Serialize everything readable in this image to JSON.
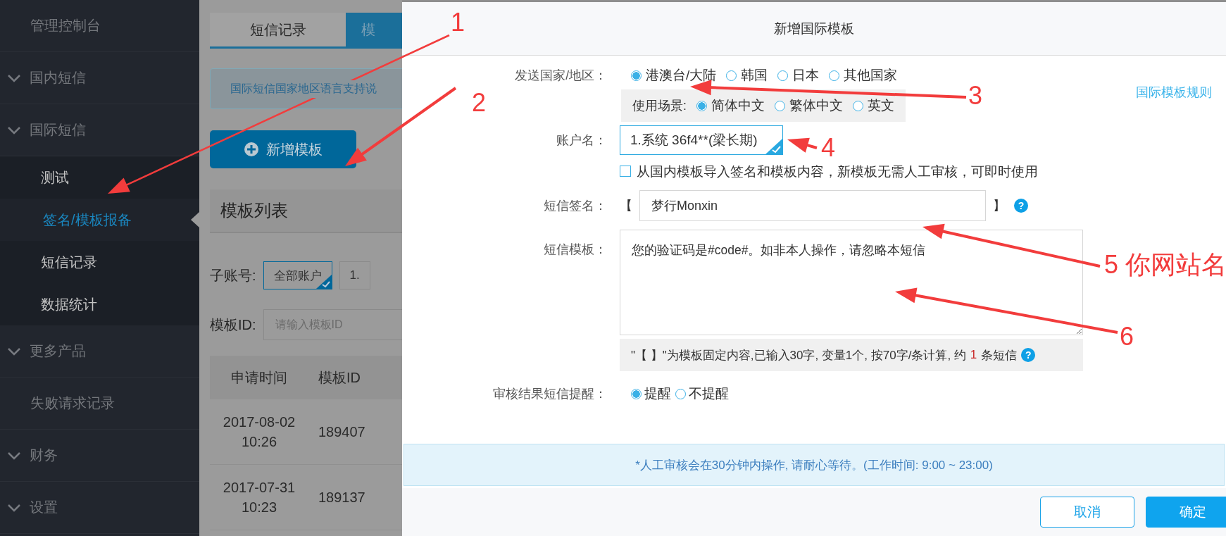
{
  "sidebar": {
    "items": [
      {
        "label": "管理控制台",
        "kind": "link",
        "selected": false
      },
      {
        "label": "国内短信",
        "kind": "group",
        "selected": false
      },
      {
        "label": "国际短信",
        "kind": "group",
        "selected": false,
        "children": [
          {
            "label": "测试",
            "selected": false
          },
          {
            "label": "签名/模板报备",
            "selected": true
          },
          {
            "label": "短信记录",
            "selected": false
          },
          {
            "label": "数据统计",
            "selected": false
          }
        ]
      },
      {
        "label": "更多产品",
        "kind": "group",
        "selected": false
      },
      {
        "label": "失败请求记录",
        "kind": "link",
        "selected": false
      },
      {
        "label": "财务",
        "kind": "group",
        "selected": false
      },
      {
        "label": "设置",
        "kind": "group",
        "selected": false
      }
    ]
  },
  "page": {
    "tabs": [
      {
        "label": "短信记录",
        "selected": false
      },
      {
        "label": "模",
        "selected": true
      }
    ],
    "notice": "国际短信国家地区语言支持说",
    "add_button": "新增模板",
    "list_title": "模板列表",
    "subaccount": {
      "label": "子账号:",
      "options": [
        {
          "label": "全部账户",
          "selected": true
        },
        {
          "label": "1.",
          "selected": false
        }
      ]
    },
    "template_id": {
      "label": "模板ID:",
      "placeholder": "请输入模板ID"
    },
    "table": {
      "columns": [
        "申请时间",
        "模板ID"
      ],
      "rows": [
        [
          "2017-08-02\n10:26",
          "189407"
        ],
        [
          "2017-07-31\n10:23",
          "189137"
        ]
      ]
    }
  },
  "dialog": {
    "title": "新增国际模板",
    "rules_link": "国际模板规则",
    "country": {
      "label": "发送国家/地区：",
      "options": [
        {
          "label": "港澳台/大陆",
          "selected": true
        },
        {
          "label": "韩国",
          "selected": false
        },
        {
          "label": "日本",
          "selected": false
        },
        {
          "label": "其他国家",
          "selected": false
        }
      ]
    },
    "scene": {
      "label": "使用场景:",
      "options": [
        {
          "label": "简体中文",
          "selected": true
        },
        {
          "label": "繁体中文",
          "selected": false
        },
        {
          "label": "英文",
          "selected": false
        }
      ]
    },
    "account": {
      "label": "账户名：",
      "value": "1.系统 36f4**(梁长期)"
    },
    "import": {
      "label": "从国内模板导入签名和模板内容，新模板无需人工审核，可即时使用",
      "checked": false
    },
    "signature": {
      "label": "短信签名：",
      "open": "【",
      "close": "】",
      "value": "梦行Monxin",
      "help": "?"
    },
    "template": {
      "label": "短信模板：",
      "value": "您的验证码是#code#。如非本人操作，请忽略本短信"
    },
    "count": {
      "before": "\"【 】\"为模板固定内容,已输入30字, 变量1个, 按70字/条计算, 约",
      "value": "1",
      "after": "条短信",
      "help": "?"
    },
    "notify": {
      "label": "审核结果短信提醒：",
      "options": [
        {
          "label": "提醒",
          "selected": true
        },
        {
          "label": "不提醒",
          "selected": false
        }
      ]
    },
    "info": "*人工审核会在30分钟内操作, 请耐心等待。(工作时间: 9:00 ~ 23:00)",
    "buttons": [
      {
        "label": "取消",
        "kind": "secondary"
      },
      {
        "label": "确定",
        "kind": "primary"
      }
    ]
  },
  "annotations": [
    {
      "label": "1"
    },
    {
      "label": "2"
    },
    {
      "label": "3"
    },
    {
      "label": "4"
    },
    {
      "label": "5 你网站名"
    },
    {
      "label": "6"
    }
  ]
}
